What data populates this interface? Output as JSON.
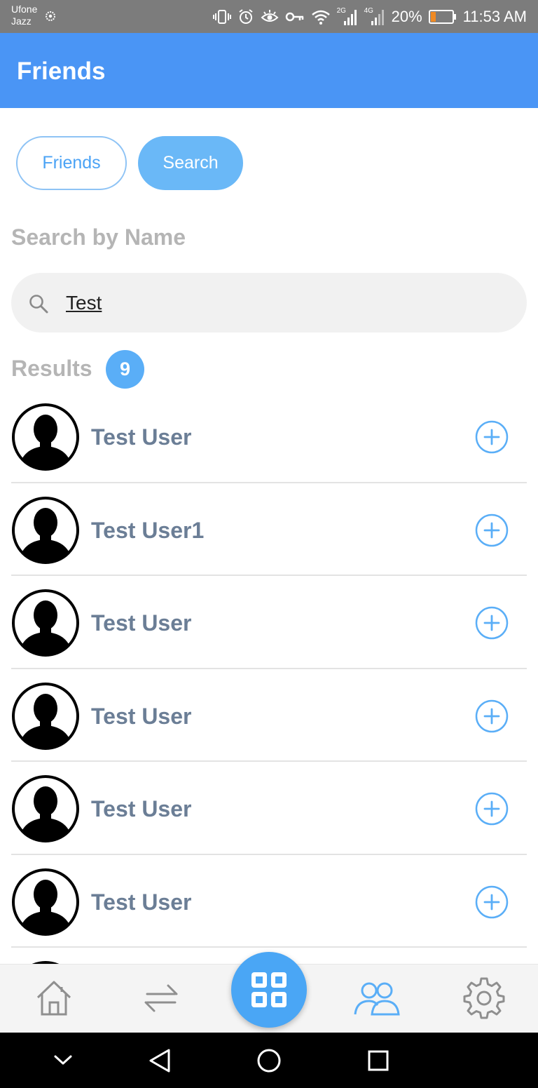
{
  "status_bar": {
    "carrier_line1": "Ufone",
    "carrier_line2": "Jazz",
    "network_2g": "2G",
    "network_4g": "4G",
    "battery": "20%",
    "time": "11:53 AM"
  },
  "app_bar": {
    "title": "Friends"
  },
  "toggle": {
    "friends_label": "Friends",
    "search_label": "Search",
    "selected": "Search"
  },
  "search": {
    "heading": "Search by Name",
    "value": "Test"
  },
  "results": {
    "label": "Results",
    "count": "9",
    "items": [
      {
        "name": "Test User"
      },
      {
        "name": "Test User1"
      },
      {
        "name": "Test User"
      },
      {
        "name": "Test User"
      },
      {
        "name": "Test User"
      },
      {
        "name": "Test User"
      },
      {
        "name": ""
      }
    ]
  },
  "bottom_tabs": {
    "items": [
      "home-icon",
      "transfer-icon",
      "grid-icon",
      "friends-icon",
      "gear-icon"
    ],
    "active": "grid-icon"
  },
  "colors": {
    "primary": "#4a95f5",
    "accent": "#5aaef7",
    "name_text": "#6b7e96",
    "muted_text": "#b5b5b5"
  }
}
